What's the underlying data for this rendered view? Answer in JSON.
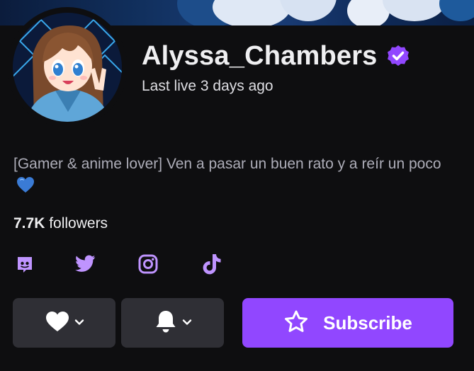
{
  "channel": {
    "name": "Alyssa_Chambers",
    "verified": true,
    "last_live": "Last live 3 days ago",
    "bio_text": "[Gamer & anime lover] Ven a pasar un buen rato y  a reír un poco",
    "bio_emoji": "blue-heart",
    "followers_count": "7.7K",
    "followers_label": " followers"
  },
  "socials": [
    {
      "icon": "discord-icon"
    },
    {
      "icon": "twitter-icon"
    },
    {
      "icon": "instagram-icon"
    },
    {
      "icon": "tiktok-icon"
    }
  ],
  "actions": {
    "follow_icon": "heart-icon",
    "notify_icon": "bell-icon",
    "subscribe_icon": "star-icon",
    "subscribe_label": "Subscribe"
  },
  "colors": {
    "background": "#0e0e10",
    "accent": "#9147ff",
    "icon_purple": "#bf94ff",
    "button_gray": "#2f2f35",
    "heart_blue": "#3a7bd5"
  }
}
